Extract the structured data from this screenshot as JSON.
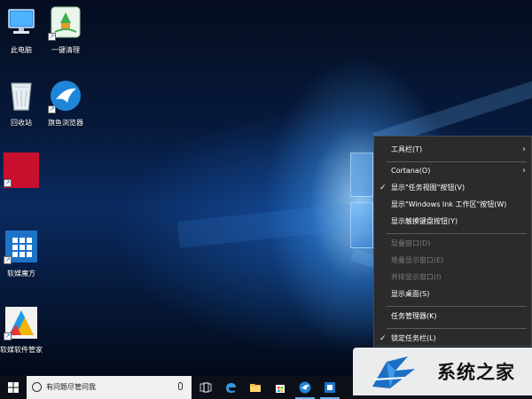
{
  "desktop": {
    "icons": [
      {
        "label": "此电脑",
        "icon": "computer-icon"
      },
      {
        "label": "一键清理",
        "icon": "cleanup-icon"
      },
      {
        "label": "回收站",
        "icon": "recycle-bin-icon"
      },
      {
        "label": "旗鱼浏览器",
        "icon": "browser-icon"
      },
      {
        "label": "",
        "icon": "red-tile-icon"
      },
      {
        "label": "软媒魔方",
        "icon": "cube-icon"
      },
      {
        "label": "软媒软件管家",
        "icon": "software-manager-icon"
      }
    ]
  },
  "context_menu": {
    "items": [
      {
        "label": "工具栏(T)",
        "submenu": true
      },
      {
        "label": "Cortana(O)",
        "submenu": true
      },
      {
        "label": "显示\"任务视图\"按钮(V)",
        "checked": true
      },
      {
        "label": "显示\"Windows Ink 工作区\"按钮(W)"
      },
      {
        "label": "显示触摸键盘按钮(Y)"
      },
      {
        "label": "层叠窗口(D)",
        "disabled": true
      },
      {
        "label": "堆叠显示窗口(E)",
        "disabled": true
      },
      {
        "label": "并排显示窗口(I)",
        "disabled": true
      },
      {
        "label": "显示桌面(S)"
      },
      {
        "label": "任务管理器(K)"
      },
      {
        "label": "锁定任务栏(L)",
        "checked": true
      }
    ],
    "chevron": "›",
    "checkmark": "✓"
  },
  "taskbar": {
    "search_placeholder": "有问题尽管问我",
    "buttons": [
      "windows-start-icon",
      "task-view-icon",
      "edge-icon",
      "file-explorer-icon",
      "store-icon",
      "swordfish-browser-icon",
      "cube-app-icon"
    ]
  },
  "watermark": {
    "text": "系统之家"
  },
  "colors": {
    "menu_bg": "#2b2b2b",
    "taskbar_bg": "#0b0f17",
    "accent": "#6fb1f5"
  }
}
